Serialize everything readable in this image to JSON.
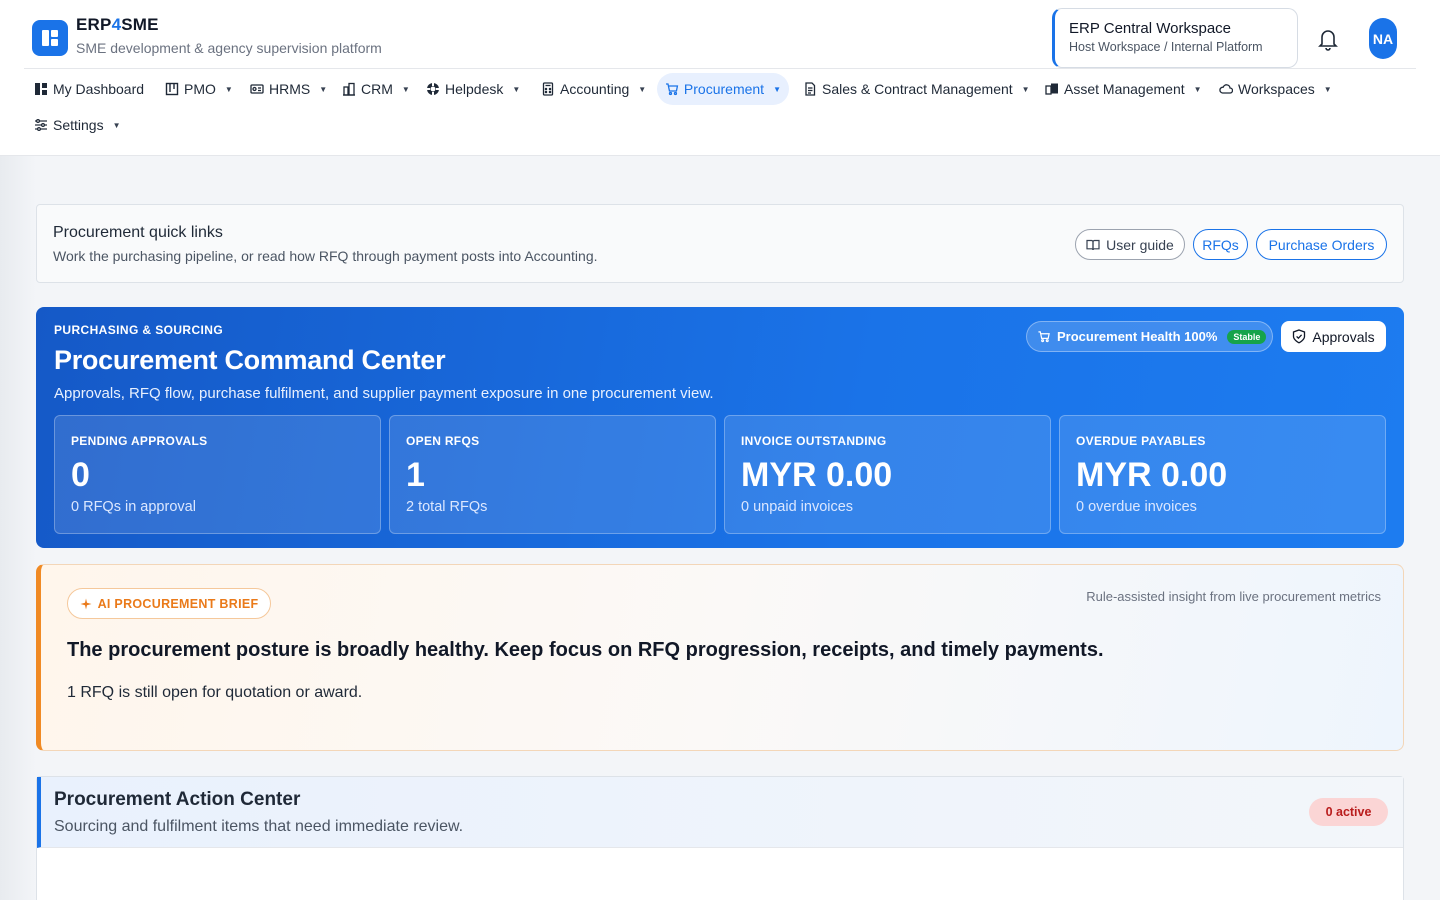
{
  "brand": {
    "name_prefix": "ERP",
    "name_accent": "4",
    "name_suffix": "SME",
    "tagline": "SME development & agency supervision platform",
    "accent_color": "#1a73e8"
  },
  "workspace": {
    "title": "ERP Central Workspace",
    "subtitle": "Host Workspace / Internal Platform"
  },
  "user": {
    "initials": "NA"
  },
  "nav": {
    "items": [
      {
        "label": "My Dashboard",
        "icon": "dashboard-icon",
        "dropdown": false
      },
      {
        "label": "PMO",
        "icon": "kanban-icon",
        "dropdown": true
      },
      {
        "label": "HRMS",
        "icon": "id-card-icon",
        "dropdown": true
      },
      {
        "label": "CRM",
        "icon": "building-icon",
        "dropdown": true
      },
      {
        "label": "Helpdesk",
        "icon": "lifebuoy-icon",
        "dropdown": true
      },
      {
        "label": "Accounting",
        "icon": "calculator-icon",
        "dropdown": true
      },
      {
        "label": "Procurement",
        "icon": "cart-icon",
        "dropdown": true,
        "active": true
      },
      {
        "label": "Sales & Contract Management",
        "icon": "document-icon",
        "dropdown": true
      },
      {
        "label": "Asset Management",
        "icon": "devices-icon",
        "dropdown": true
      },
      {
        "label": "Workspaces",
        "icon": "cloud-icon",
        "dropdown": true
      },
      {
        "label": "Settings",
        "icon": "sliders-icon",
        "dropdown": true
      }
    ]
  },
  "quick_links": {
    "title": "Procurement quick links",
    "subtitle": "Work the purchasing pipeline, or read how RFQ through payment posts into Accounting.",
    "user_guide": "User guide",
    "rfqs": "RFQs",
    "purchase_orders": "Purchase Orders"
  },
  "command_center": {
    "eyebrow": "PURCHASING & SOURCING",
    "title": "Procurement Command Center",
    "subtitle": "Approvals, RFQ flow, purchase fulfilment, and supplier payment exposure in one procurement view.",
    "health_label": "Procurement Health 100%",
    "health_status": "Stable",
    "approvals_label": "Approvals",
    "stats": [
      {
        "label": "PENDING APPROVALS",
        "value": "0",
        "note": "0 RFQs in approval"
      },
      {
        "label": "OPEN RFQS",
        "value": "1",
        "note": "2 total RFQs"
      },
      {
        "label": "INVOICE OUTSTANDING",
        "value": "MYR 0.00",
        "note": "0 unpaid invoices"
      },
      {
        "label": "OVERDUE PAYABLES",
        "value": "MYR 0.00",
        "note": "0 overdue invoices"
      }
    ]
  },
  "ai_brief": {
    "badge": "AI PROCUREMENT BRIEF",
    "meta": "Rule-assisted insight from live procurement metrics",
    "headline": "The procurement posture is broadly healthy. Keep focus on RFQ progression, receipts, and timely payments.",
    "body": "1 RFQ is still open for quotation or award."
  },
  "action_center": {
    "title": "Procurement Action Center",
    "subtitle": "Sourcing and fulfilment items that need immediate review.",
    "badge": "0 active"
  }
}
